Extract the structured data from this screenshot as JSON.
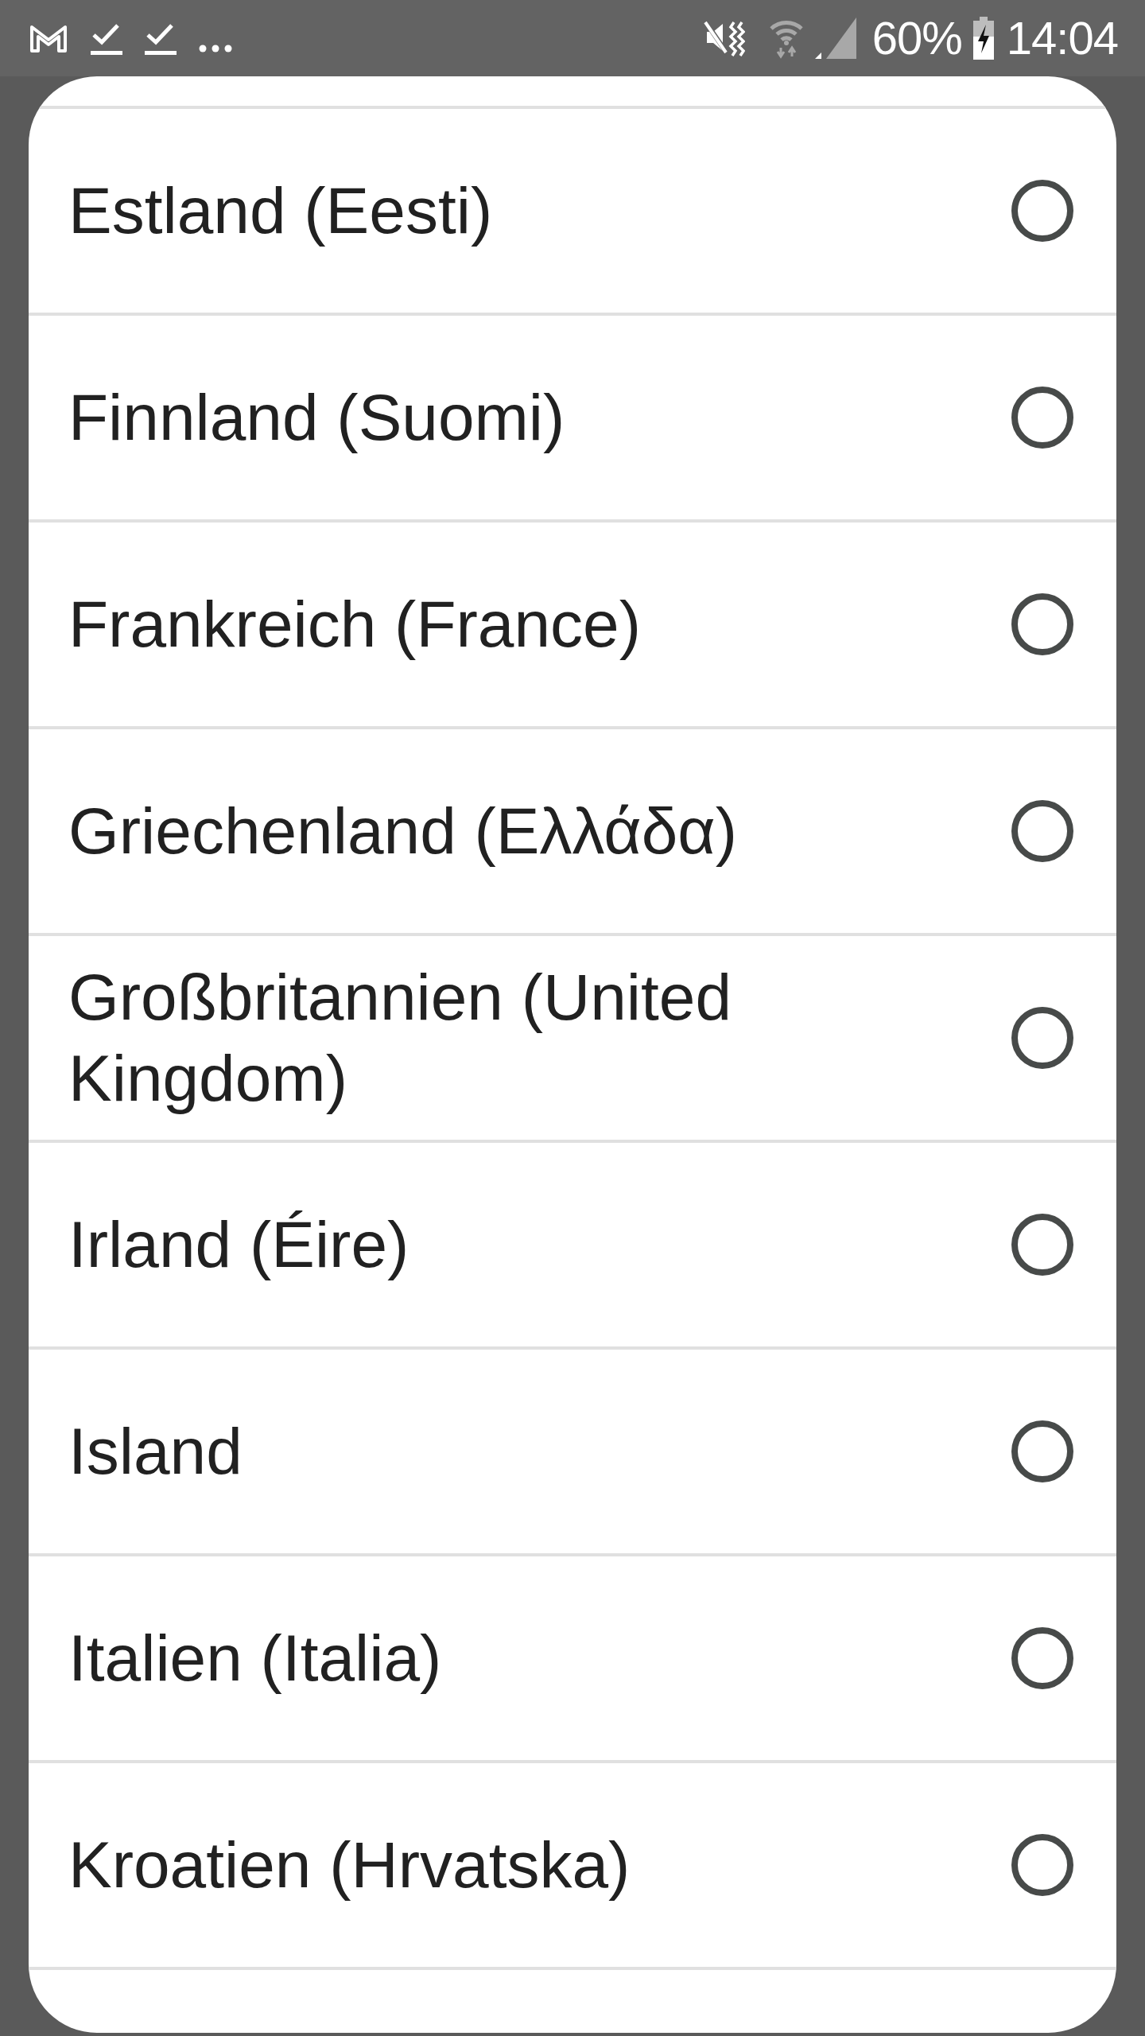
{
  "status_bar": {
    "battery": "60%",
    "time": "14:04"
  },
  "dialog": {
    "options": [
      {
        "label": "Estland (Eesti)",
        "selected": false
      },
      {
        "label": "Finnland (Suomi)",
        "selected": false
      },
      {
        "label": "Frankreich (France)",
        "selected": false
      },
      {
        "label": "Griechenland (Ελλάδα)",
        "selected": false
      },
      {
        "label": "Großbritannien (United Kingdom)",
        "selected": false
      },
      {
        "label": "Irland (Éire)",
        "selected": false
      },
      {
        "label": "Island",
        "selected": false
      },
      {
        "label": "Italien (Italia)",
        "selected": false
      },
      {
        "label": "Kroatien (Hrvatska)",
        "selected": false
      }
    ]
  }
}
